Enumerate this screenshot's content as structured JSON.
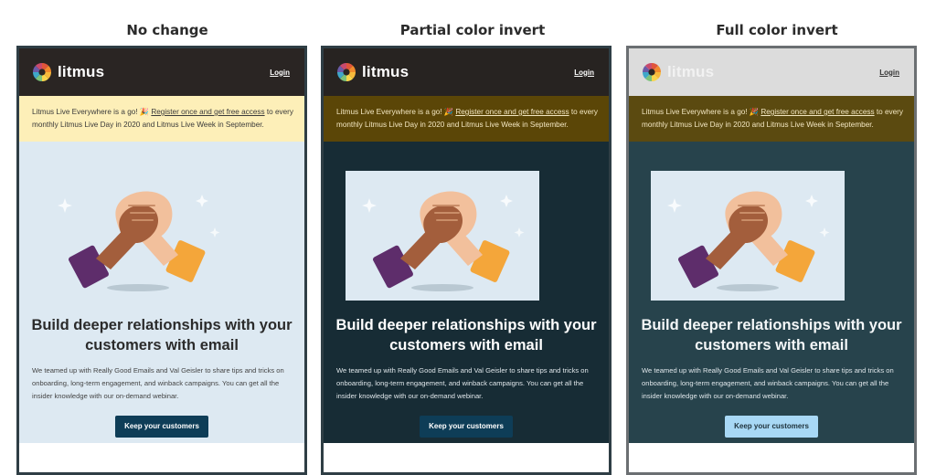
{
  "columns": [
    {
      "title": "No change"
    },
    {
      "title": "Partial color invert"
    },
    {
      "title": "Full color invert"
    }
  ],
  "email": {
    "brand": "litmus",
    "login": "Login",
    "banner_pre": "Litmus Live Everywhere is a go! 🎉 ",
    "banner_link": "Register once and get free access",
    "banner_post": " to every monthly Litmus Live Day in 2020 and Litmus Live Week in September.",
    "headline": "Build deeper relationships with your customers with email",
    "body": "We teamed up with Really Good Emails and Val Geisler to share tips and tricks on onboarding, long-term engagement, and winback campaigns. You can get all the insider knowledge with our on-demand webinar.",
    "cta": "Keep your customers"
  },
  "colors": {
    "cta_dark": "#0e3d57",
    "cta_light": "#a8d8f5",
    "banner_light": "#fdefb8",
    "banner_dark": "#5b4607"
  }
}
